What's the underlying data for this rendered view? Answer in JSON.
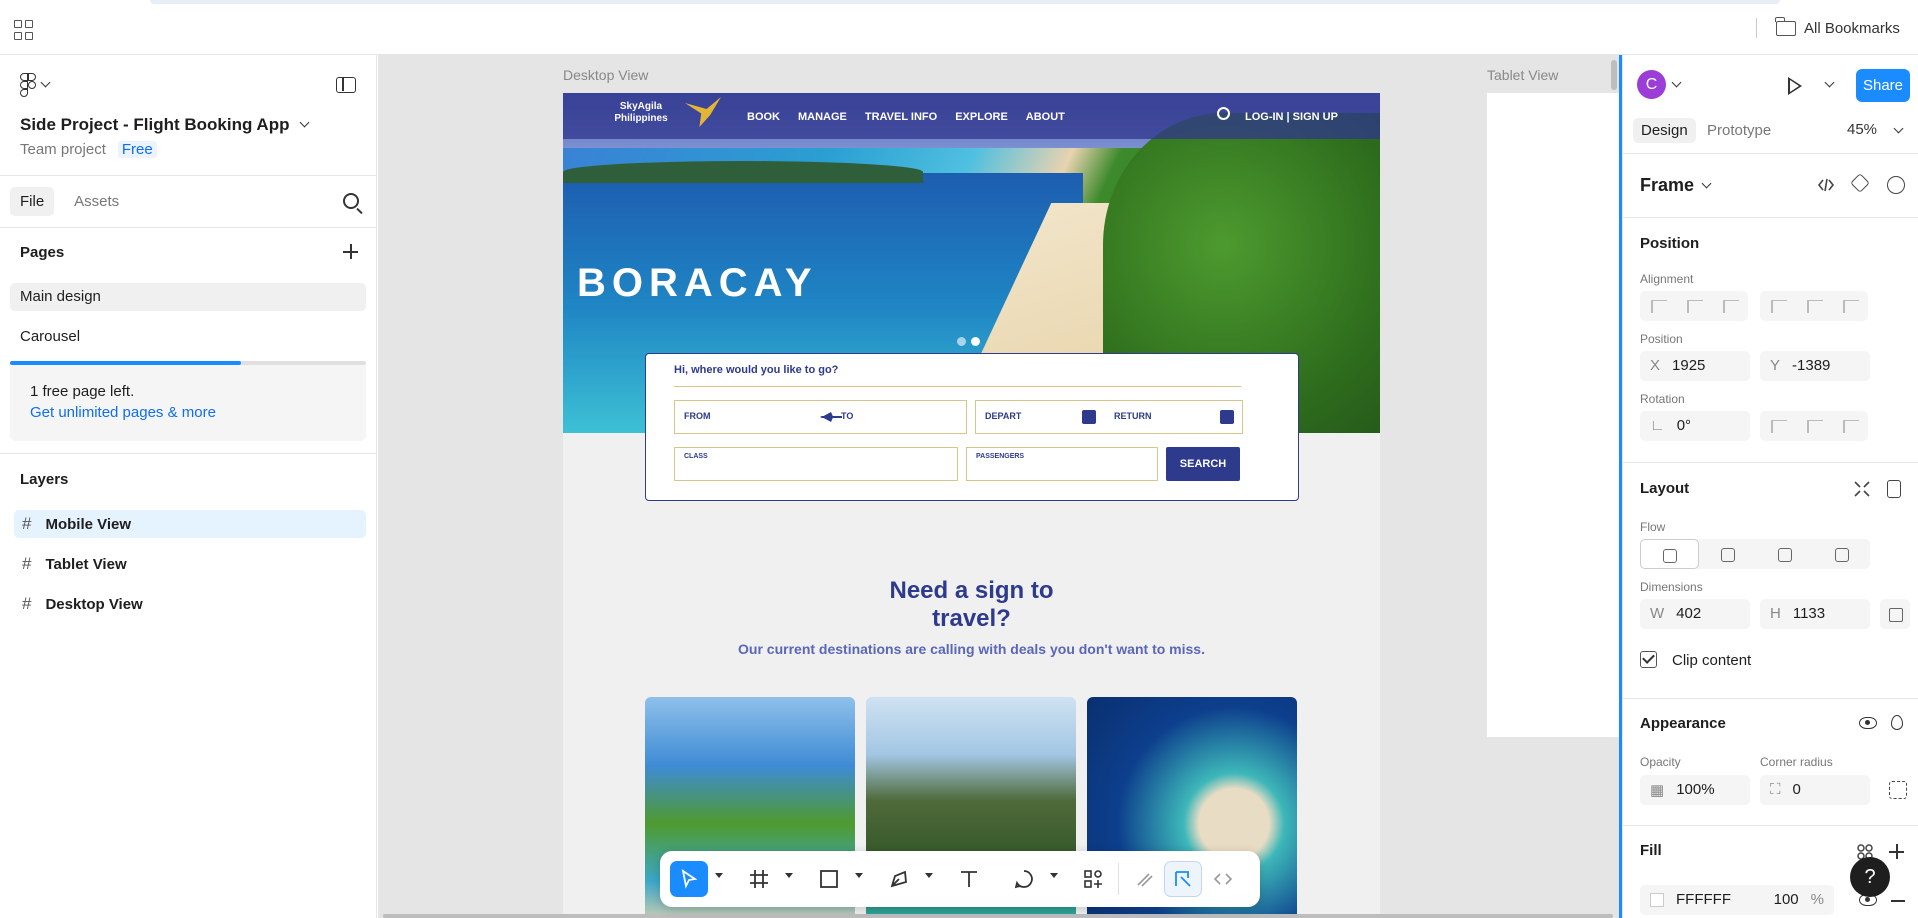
{
  "browser": {
    "bookmarks_label": "All Bookmarks"
  },
  "left_panel": {
    "project_title": "Side Project - Flight Booking App",
    "team": "Team project",
    "plan": "Free",
    "tabs": [
      "File",
      "Assets"
    ],
    "pages_title": "Pages",
    "pages": [
      "Main design",
      "Carousel"
    ],
    "pages_progress": 0.65,
    "upsell_text": "1 free page left.",
    "upsell_link": "Get unlimited pages & more",
    "layers_title": "Layers",
    "layers": [
      "Mobile View",
      "Tablet View",
      "Desktop View"
    ]
  },
  "canvas": {
    "desktop_label": "Desktop View",
    "tablet_label": "Tablet View",
    "site": {
      "brand": "SkyAgila Philippines",
      "nav_links": [
        "BOOK",
        "MANAGE",
        "TRAVEL INFO",
        "EXPLORE",
        "ABOUT"
      ],
      "login": "LOG-IN | SIGN UP",
      "hero_title": "BORACAY",
      "booking_question": "Hi, where would you like to go?",
      "fields": {
        "from": "FROM",
        "to": "TO",
        "depart": "DEPART",
        "return": "RETURN",
        "class": "CLASS",
        "passengers": "PASSENGERS"
      },
      "search_button": "SEARCH",
      "promo_title": "Need a sign to travel?",
      "promo_subtitle": "Our current destinations are calling with deals you don't want to miss."
    }
  },
  "right_panel": {
    "avatar_initial": "C",
    "share_label": "Share",
    "tabs": [
      "Design",
      "Prototype"
    ],
    "zoom": "45%",
    "frame_label": "Frame",
    "position_title": "Position",
    "alignment_label": "Alignment",
    "position_label": "Position",
    "x_key": "X",
    "x_value": "1925",
    "y_key": "Y",
    "y_value": "-1389",
    "rotation_label": "Rotation",
    "rotation_value": "0°",
    "layout_title": "Layout",
    "flow_label": "Flow",
    "dimensions_label": "Dimensions",
    "w_key": "W",
    "w_value": "402",
    "h_key": "H",
    "h_value": "1133",
    "clip_content": "Clip content",
    "appearance_title": "Appearance",
    "opacity_label": "Opacity",
    "opacity_value": "100%",
    "corner_label": "Corner radius",
    "corner_value": "0",
    "fill_title": "Fill",
    "fill_hex": "FFFFFF",
    "fill_opacity": "100",
    "fill_unit": "%"
  },
  "colors": {
    "accent": "#1a8cff",
    "brand_navy": "#2e3a8c"
  },
  "help_label": "?"
}
